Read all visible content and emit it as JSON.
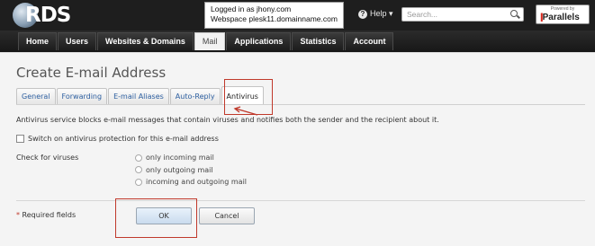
{
  "header": {
    "logo_text": "RDS",
    "login_line1": "Logged in as jhony.com",
    "login_line2": "Webspace plesk11.domainname.com",
    "help_label": "Help ▾",
    "search_placeholder": "Search...",
    "powered_by": "Powered by",
    "parallels": "Parallels"
  },
  "nav": {
    "items": [
      {
        "label": "Home"
      },
      {
        "label": "Users"
      },
      {
        "label": "Websites & Domains"
      },
      {
        "label": "Mail"
      },
      {
        "label": "Applications"
      },
      {
        "label": "Statistics"
      },
      {
        "label": "Account"
      }
    ],
    "active": "Mail"
  },
  "page": {
    "title": "Create E-mail Address",
    "tabs": [
      {
        "label": "General"
      },
      {
        "label": "Forwarding"
      },
      {
        "label": "E-mail Aliases"
      },
      {
        "label": "Auto-Reply"
      },
      {
        "label": "Antivirus"
      }
    ],
    "active_tab": "Antivirus",
    "description": "Antivirus service blocks e-mail messages that contain viruses and notifies both the sender and the recipient about it.",
    "switch_label": "Switch on antivirus protection for this e-mail address",
    "switch_checked": false,
    "check_label": "Check for viruses",
    "radio_options": [
      {
        "label": "only incoming mail"
      },
      {
        "label": "only outgoing mail"
      },
      {
        "label": "incoming and outgoing mail"
      }
    ],
    "required_star": "*",
    "required_label": "Required fields",
    "ok_label": "OK",
    "cancel_label": "Cancel"
  },
  "colors": {
    "header_bg": "#1e1e1e",
    "link_blue": "#2d5fa0",
    "annotation_red": "#c0392b"
  }
}
